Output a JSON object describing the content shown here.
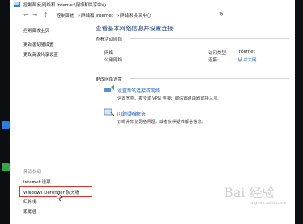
{
  "window": {
    "title": "控制面板\\网络和 Internet\\网络和共享中心",
    "nav": {
      "back": "←",
      "forward": "→",
      "up": "↑"
    },
    "breadcrumbs": [
      "控制面板",
      "网络和 Internet",
      "网络和共享中心"
    ],
    "refresh": "↻"
  },
  "sidebar": {
    "items": [
      {
        "label": "控制面板主页"
      },
      {
        "label": "更改适配器设置"
      },
      {
        "label": "更改高级共享设置"
      }
    ],
    "see_also_header": "另请参阅",
    "see_also": [
      {
        "label": "Internet 选项"
      },
      {
        "label": "Windows Defender 防火墙"
      },
      {
        "label": "红外线"
      },
      {
        "label": "家庭组"
      }
    ]
  },
  "main": {
    "title": "查看基本网络信息并设置连接",
    "active_networks_label": "查看活动网络",
    "network": {
      "name": "网络",
      "type": "公用网络"
    },
    "access_type_key": "访问类型:",
    "access_type_value": "Internet",
    "connections_key": "连接:",
    "connections_value": "以太网",
    "change_settings_label": "更改网络设置",
    "tasks": [
      {
        "link": "设置新的连接或网络",
        "desc": "设置宽带、拨号或 VPN 连接；或设置路由器或接入点。"
      },
      {
        "link": "问题疑难解答",
        "desc": "诊断并修复网络问题，或者获得疑难解答信息。"
      }
    ]
  },
  "watermark": {
    "text": "Bai 经验",
    "sub": "jingyan.baidu.com"
  },
  "colors": {
    "accent_link": "#1b5fb5",
    "title_blue": "#1e3c73",
    "highlight_red": "#e03030"
  }
}
